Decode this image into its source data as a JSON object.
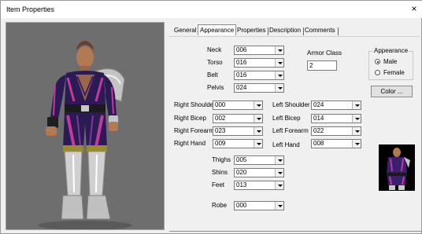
{
  "window": {
    "title": "Item Properties",
    "close_glyph": "×"
  },
  "tabs": [
    {
      "label": "General",
      "selected": false
    },
    {
      "label": "Appearance",
      "selected": true
    },
    {
      "label": "Properties",
      "selected": false
    },
    {
      "label": "Description",
      "selected": false
    },
    {
      "label": "Comments",
      "selected": false
    }
  ],
  "body": {
    "neck": {
      "label": "Neck",
      "value": "006"
    },
    "torso": {
      "label": "Torso",
      "value": "016"
    },
    "belt": {
      "label": "Belt",
      "value": "016"
    },
    "pelvis": {
      "label": "Pelvis",
      "value": "024"
    }
  },
  "armor_class": {
    "label": "Armor Class",
    "value": "2"
  },
  "appearance": {
    "group_label": "Appearance",
    "options": [
      {
        "label": "Male",
        "selected": true
      },
      {
        "label": "Female",
        "selected": false
      }
    ]
  },
  "color_button": "Color ...",
  "right_side": {
    "shoulder": {
      "label": "Right Shoulder",
      "value": "000"
    },
    "bicep": {
      "label": "Right Bicep",
      "value": "002"
    },
    "forearm": {
      "label": "Right Forearm",
      "value": "023"
    },
    "hand": {
      "label": "Right Hand",
      "value": "009"
    }
  },
  "left_side": {
    "shoulder": {
      "label": "Left Shoulder",
      "value": "024"
    },
    "bicep": {
      "label": "Left Bicep",
      "value": "014"
    },
    "forearm": {
      "label": "Left Forearm",
      "value": "022"
    },
    "hand": {
      "label": "Left Hand",
      "value": "008"
    }
  },
  "legs": {
    "thighs": {
      "label": "Thighs",
      "value": "005"
    },
    "shins": {
      "label": "Shins",
      "value": "020"
    },
    "feet": {
      "label": "Feet",
      "value": "013"
    }
  },
  "robe": {
    "label": "Robe",
    "value": "000"
  },
  "colors": {
    "viewport_bg": "#6e6e6e",
    "armor_purple": "#3a1f6e",
    "armor_magenta": "#c23a9c",
    "armor_silver": "#c8c8c8"
  }
}
